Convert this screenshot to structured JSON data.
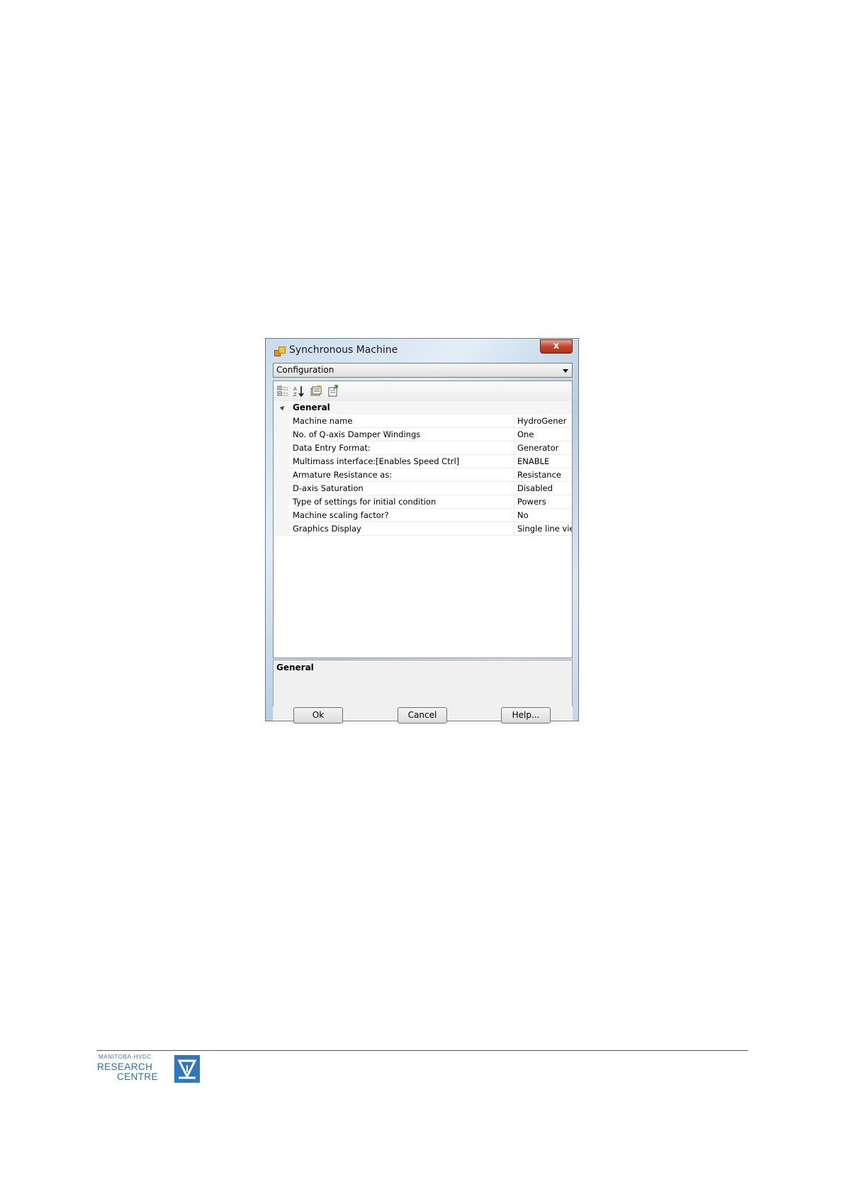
{
  "dialog": {
    "title": "Synchronous Machine",
    "close_label": "x",
    "dropdown_value": "Configuration",
    "toolbar": {
      "icons": [
        "categorized-icon",
        "alphabetical-sort-icon",
        "property-pages-icon",
        "export-icon"
      ]
    },
    "category": "General",
    "properties": [
      {
        "name": "Machine name",
        "value": "HydroGener"
      },
      {
        "name": "No. of Q-axis Damper Windings",
        "value": "One"
      },
      {
        "name": "Data Entry Format:",
        "value": "Generator"
      },
      {
        "name": "Multimass interface:[Enables Speed Ctrl]",
        "value": "ENABLE"
      },
      {
        "name": "Armature Resistance as:",
        "value": "Resistance"
      },
      {
        "name": "D-axis Saturation",
        "value": "Disabled"
      },
      {
        "name": "Type of settings for initial condition",
        "value": "Powers"
      },
      {
        "name": "Machine scaling factor?",
        "value": "No"
      },
      {
        "name": "Graphics Display",
        "value": "Single line view"
      }
    ],
    "description_title": "General",
    "buttons": {
      "ok": "Ok",
      "cancel": "Cancel",
      "help": "Help..."
    }
  },
  "footer": {
    "logo_line1": "MANITOBA-HVDC",
    "logo_line2": "RESEARCH",
    "logo_line3": "CENTRE",
    "brand_color": "#2f78bf"
  }
}
